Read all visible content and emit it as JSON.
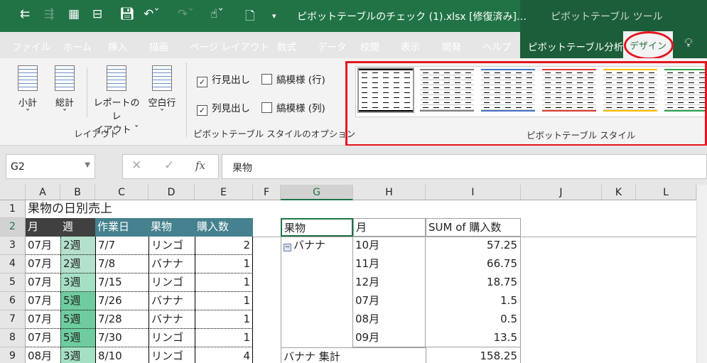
{
  "titlebar": {
    "title": "ピボットテーブルのチェック (1).xlsx [修復済み]…",
    "tool_context": "ピボットテーブル ツール"
  },
  "tabs": [
    "ファイル",
    "ホーム",
    "挿入",
    "描画",
    "ページ レイアウト",
    "数式",
    "データ",
    "校閲",
    "表示",
    "開発",
    "ヘルプ",
    "ピボットテーブル分析"
  ],
  "active_tab": "デザイン",
  "ribbon": {
    "layout": {
      "subtotal": "小計",
      "grandtotal": "総計",
      "report_layout_1": "レポートのレ",
      "report_layout_2": "イアウト",
      "blank_rows": "空白行",
      "group": "レイアウト"
    },
    "options": {
      "row_headers": "行見出し",
      "col_headers": "列見出し",
      "banded_rows": "縞模様 (行)",
      "banded_cols": "縞模様 (列)",
      "row_headers_checked": true,
      "col_headers_checked": true,
      "group": "ピボットテーブル スタイルのオプション"
    },
    "styles": {
      "group": "ピボットテーブル スタイル",
      "swatch_colors": [
        "#000000",
        "#7f7f7f",
        "#4472c4",
        "#e03c31",
        "#ffc000",
        "#2ea44f"
      ]
    }
  },
  "formula": {
    "name_box": "G2",
    "value": "果物",
    "fx": "fx"
  },
  "columns": [
    "A",
    "B",
    "C",
    "D",
    "E",
    "F",
    "G",
    "H",
    "I",
    "J",
    "K",
    "L"
  ],
  "rows": [
    "1",
    "2",
    "3",
    "4",
    "5",
    "6",
    "7",
    "8",
    "9"
  ],
  "sheet": {
    "title": "果物の日別売上",
    "headers": [
      "月",
      "週",
      "作業日",
      "果物",
      "購入数"
    ],
    "data": [
      [
        "07月",
        "2週",
        "7/7",
        "リンゴ",
        "2"
      ],
      [
        "07月",
        "2週",
        "7/8",
        "バナナ",
        "1"
      ],
      [
        "07月",
        "3週",
        "7/15",
        "リンゴ",
        "1"
      ],
      [
        "07月",
        "5週",
        "7/26",
        "バナナ",
        "1"
      ],
      [
        "07月",
        "5週",
        "7/28",
        "バナナ",
        "1"
      ],
      [
        "07月",
        "5週",
        "7/30",
        "リンゴ",
        "1"
      ],
      [
        "08月",
        "3週",
        "8/10",
        "リンゴ",
        "4"
      ]
    ]
  },
  "pivot": {
    "headers": [
      "果物",
      "月",
      "SUM of 購入数"
    ],
    "group": "バナナ",
    "rows": [
      [
        "10月",
        "57.25"
      ],
      [
        "11月",
        "66.75"
      ],
      [
        "12月",
        "18.75"
      ],
      [
        "07月",
        "1.5"
      ],
      [
        "08月",
        "0.5"
      ],
      [
        "09月",
        "13.5"
      ]
    ],
    "subtotal_label": "バナナ 集計",
    "subtotal_value": "158.25"
  }
}
